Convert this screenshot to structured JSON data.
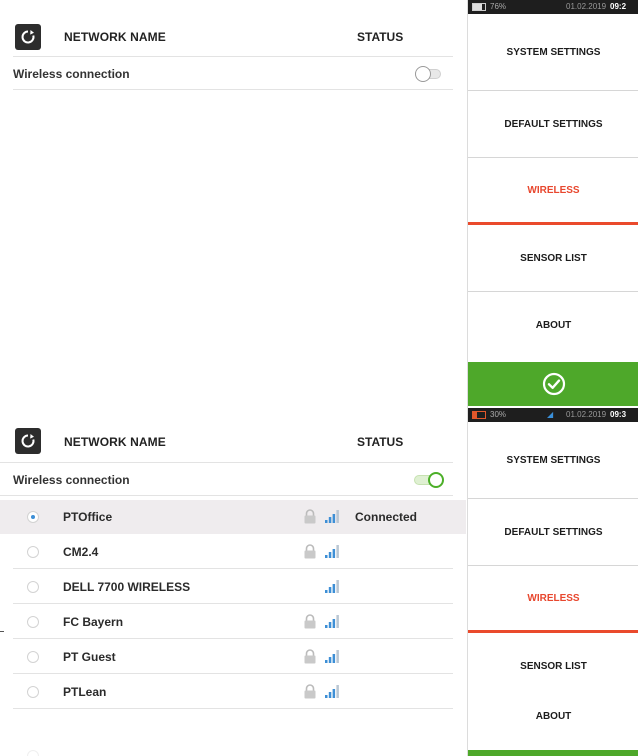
{
  "colors": {
    "accent": "#ea4a2c",
    "confirm": "#4ea82a",
    "signal": "#3d8fd6",
    "statusbar": "#1e1e1e"
  },
  "top": {
    "header": {
      "refresh_icon": "refresh-icon",
      "col_name": "NETWORK NAME",
      "col_status": "STATUS"
    },
    "wireless_label": "Wireless connection",
    "wireless_on": false,
    "statusbar": {
      "battery": "76%",
      "battery_level": 0.76,
      "date": "01.02.2019",
      "time": "09:2"
    },
    "menu": [
      {
        "label": "SYSTEM SETTINGS",
        "active": false
      },
      {
        "label": "DEFAULT SETTINGS",
        "active": false
      },
      {
        "label": "WIRELESS",
        "active": true
      },
      {
        "label": "SENSOR LIST",
        "active": false
      },
      {
        "label": "ABOUT",
        "active": false
      }
    ],
    "confirm_icon": "check-circle-icon"
  },
  "bottom": {
    "header": {
      "refresh_icon": "refresh-icon",
      "col_name": "NETWORK NAME",
      "col_status": "STATUS"
    },
    "wireless_label": "Wireless connection",
    "wireless_on": true,
    "statusbar": {
      "battery": "30%",
      "battery_level": 0.3,
      "date": "01.02.2019",
      "time": "09:3"
    },
    "networks": [
      {
        "name": "PTOffice",
        "secured": true,
        "selected": true,
        "status": "Connected"
      },
      {
        "name": "CM2.4",
        "secured": true,
        "selected": false,
        "status": ""
      },
      {
        "name": "DELL 7700 WIRELESS",
        "secured": false,
        "selected": false,
        "status": ""
      },
      {
        "name": "FC Bayern",
        "secured": true,
        "selected": false,
        "status": ""
      },
      {
        "name": "PT Guest",
        "secured": true,
        "selected": false,
        "status": ""
      },
      {
        "name": "PTLean",
        "secured": true,
        "selected": false,
        "status": ""
      }
    ],
    "menu": [
      {
        "label": "SYSTEM SETTINGS",
        "active": false
      },
      {
        "label": "DEFAULT SETTINGS",
        "active": false
      },
      {
        "label": "WIRELESS",
        "active": true
      },
      {
        "label": "SENSOR LIST",
        "active": false
      },
      {
        "label": "ABOUT",
        "active": false
      }
    ]
  }
}
